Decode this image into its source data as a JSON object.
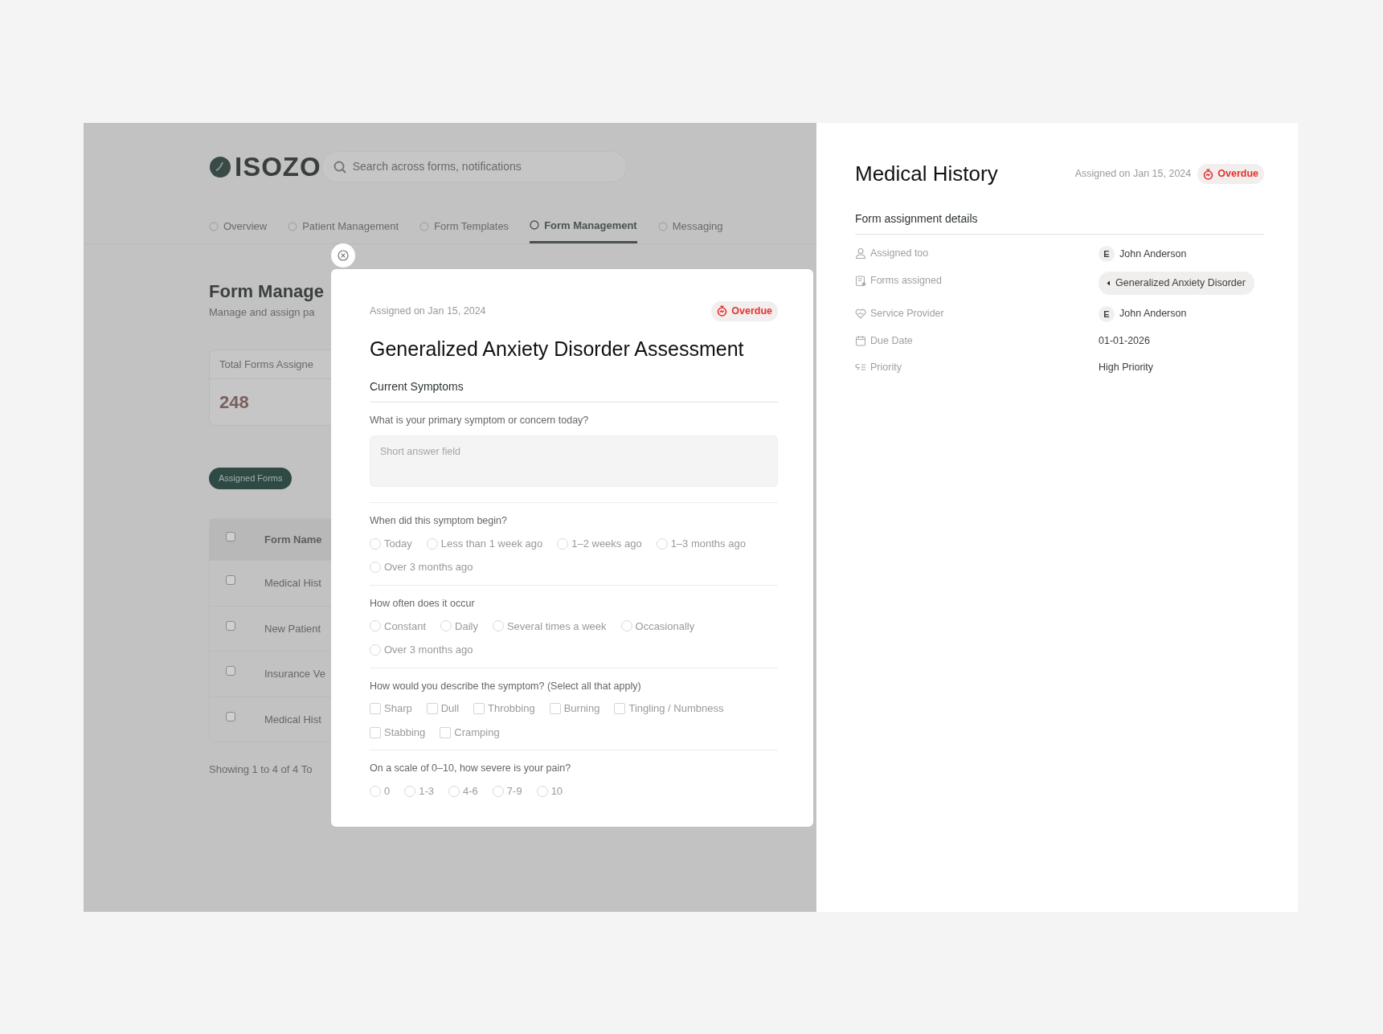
{
  "background_page": {
    "logo": "ISOZO",
    "search": {
      "placeholder": "Search across forms, notifications"
    },
    "tabs": [
      {
        "label": "Overview",
        "selected": false
      },
      {
        "label": "Patient Management",
        "selected": false
      },
      {
        "label": "Form Templates",
        "selected": false
      },
      {
        "label": "Form Management",
        "selected": true
      },
      {
        "label": "Messaging",
        "selected": false
      }
    ],
    "page_title": "Form Manage",
    "page_subtitle": "Manage and assign pa",
    "stat_card": {
      "label": "Total Forms Assigne",
      "value": "248"
    },
    "filter_button": "Assigned Forms",
    "table": {
      "all_selected": false,
      "columns": [
        "Form Name"
      ],
      "rows": [
        {
          "cells": [
            "Medical Hist"
          ],
          "checked": false
        },
        {
          "cells": [
            "New Patient"
          ],
          "checked": false
        },
        {
          "cells": [
            "Insurance Ve"
          ],
          "checked": false
        },
        {
          "cells": [
            "Medical Hist"
          ],
          "checked": false
        }
      ]
    },
    "footer": "Showing 1 to 4 of 4 To"
  },
  "modal": {
    "assigned": "Assigned on Jan 15, 2024",
    "status": "Overdue",
    "title": "Generalized Anxiety Disorder Assessment",
    "section": "Current Symptoms",
    "questions": [
      {
        "kind": "text",
        "label": "What is your primary symptom or concern today?",
        "placeholder": "Short answer field"
      },
      {
        "kind": "radio",
        "label": "When did this symptom begin?",
        "options": [
          {
            "label": "Today",
            "selected": false
          },
          {
            "label": "Less than 1 week ago",
            "selected": false
          },
          {
            "label": "1–2 weeks ago",
            "selected": false
          },
          {
            "label": "1–3 months ago",
            "selected": false
          },
          {
            "label": "Over 3 months ago",
            "selected": false
          }
        ]
      },
      {
        "kind": "radio",
        "label": "How often does it occur",
        "options": [
          {
            "label": "Constant",
            "selected": false
          },
          {
            "label": "Daily",
            "selected": false
          },
          {
            "label": "Several times a week",
            "selected": false
          },
          {
            "label": "Occasionally",
            "selected": false
          },
          {
            "label": "Over 3 months ago",
            "selected": false
          }
        ]
      },
      {
        "kind": "checkbox",
        "label": "How would you describe the symptom? (Select all that apply)",
        "options": [
          {
            "label": "Sharp",
            "checked": false
          },
          {
            "label": "Dull",
            "checked": false
          },
          {
            "label": "Throbbing",
            "checked": false
          },
          {
            "label": "Burning",
            "checked": false
          },
          {
            "label": "Tingling / Numbness",
            "checked": false
          },
          {
            "label": "Stabbing",
            "checked": false
          },
          {
            "label": "Cramping",
            "checked": false
          }
        ]
      },
      {
        "kind": "radio",
        "label": "On a scale of 0–10, how severe is your pain?",
        "options": [
          {
            "label": "0",
            "selected": false
          },
          {
            "label": "1-3",
            "selected": false
          },
          {
            "label": "4-6",
            "selected": false
          },
          {
            "label": "7-9",
            "selected": false
          },
          {
            "label": "10",
            "selected": false
          }
        ]
      }
    ]
  },
  "details_panel": {
    "title": "Medical History",
    "assigned": "Assigned on Jan 15, 2024",
    "status": "Overdue",
    "section": "Form assignment details",
    "fields": [
      {
        "kind": "person",
        "label": "Assigned too",
        "initial": "E",
        "value": "John Anderson"
      },
      {
        "kind": "chip",
        "label": "Forms assigned",
        "value": "Generalized Anxiety Disorder"
      },
      {
        "kind": "person",
        "label": "Service Provider",
        "initial": "E",
        "value": "John Anderson"
      },
      {
        "kind": "text",
        "label": "Due Date",
        "value": "01-01-2026"
      },
      {
        "kind": "text",
        "label": "Priority",
        "value": "High Priority"
      }
    ]
  }
}
